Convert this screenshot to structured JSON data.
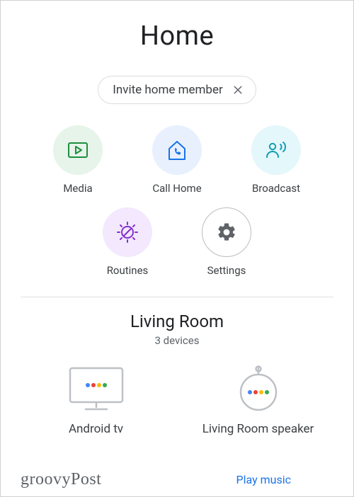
{
  "title": "Home",
  "chip": {
    "label": "Invite home member"
  },
  "actions": [
    {
      "label": "Media"
    },
    {
      "label": "Call Home"
    },
    {
      "label": "Broadcast"
    },
    {
      "label": "Routines"
    },
    {
      "label": "Settings"
    }
  ],
  "room": {
    "name": "Living Room",
    "subtitle": "3 devices"
  },
  "devices": [
    {
      "label": "Android tv"
    },
    {
      "label": "Living Room speaker"
    }
  ],
  "watermark": "groovyPost",
  "play_link": "Play music"
}
